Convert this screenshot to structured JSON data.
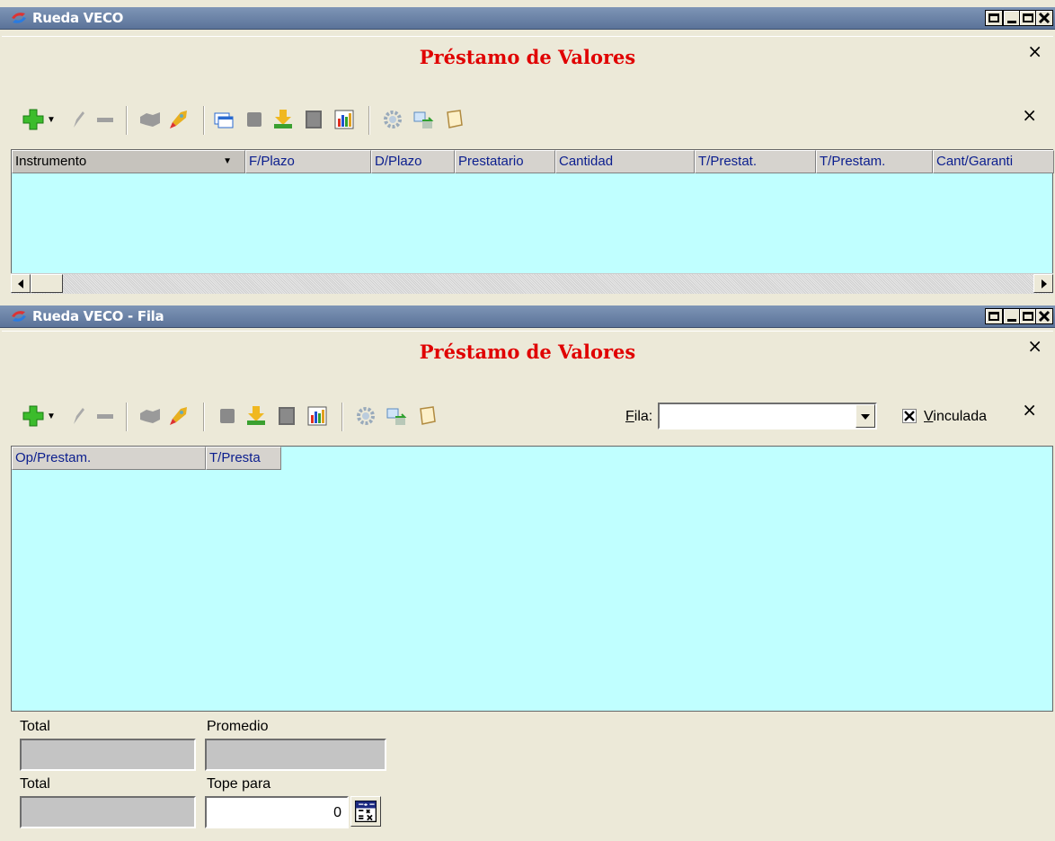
{
  "window1": {
    "title": "Rueda VECO",
    "panel_title": "Préstamo de Valores",
    "close_glyph": "×",
    "columns": [
      "Instrumento",
      "F/Plazo",
      "D/Plazo",
      "Prestatario",
      "Cantidad",
      "T/Prestat.",
      "T/Prestam.",
      "Cant/Garanti"
    ],
    "dropdown_glyph": "▼"
  },
  "window2": {
    "title": "Rueda VECO - Fila",
    "panel_title": "Préstamo de Valores",
    "close_glyph": "×",
    "fila_label": "Fila:",
    "fila_value": "",
    "vinculada_label": "Vinculada",
    "vinculada_checked": true,
    "columns": [
      "Op/Prestam.",
      "T/Presta"
    ],
    "footer": {
      "total1_label": "Total",
      "promedio_label": "Promedio",
      "total2_label": "Total",
      "tope_label": "Tope para",
      "tope_value": "0"
    }
  },
  "colors": {
    "grid_bg": "#c0ffff",
    "title_red": "#e00000",
    "header_text": "#0b1e8e"
  }
}
